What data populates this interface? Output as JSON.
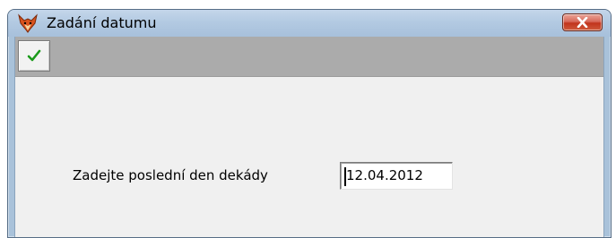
{
  "window": {
    "title": "Zadání datumu",
    "app_icon": "fox-icon",
    "close_icon": "close-icon"
  },
  "toolbar": {
    "confirm_icon": "checkmark-icon"
  },
  "form": {
    "prompt_label": "Zadejte poslední den dekády",
    "date_value": "12.04.2012"
  },
  "colors": {
    "titlebar": "#b3cae2",
    "toolbar": "#ababab",
    "client": "#f0f0f0",
    "close_button": "#c1331c",
    "checkmark": "#1a9a1a",
    "fox_icon": "#d9531e"
  }
}
